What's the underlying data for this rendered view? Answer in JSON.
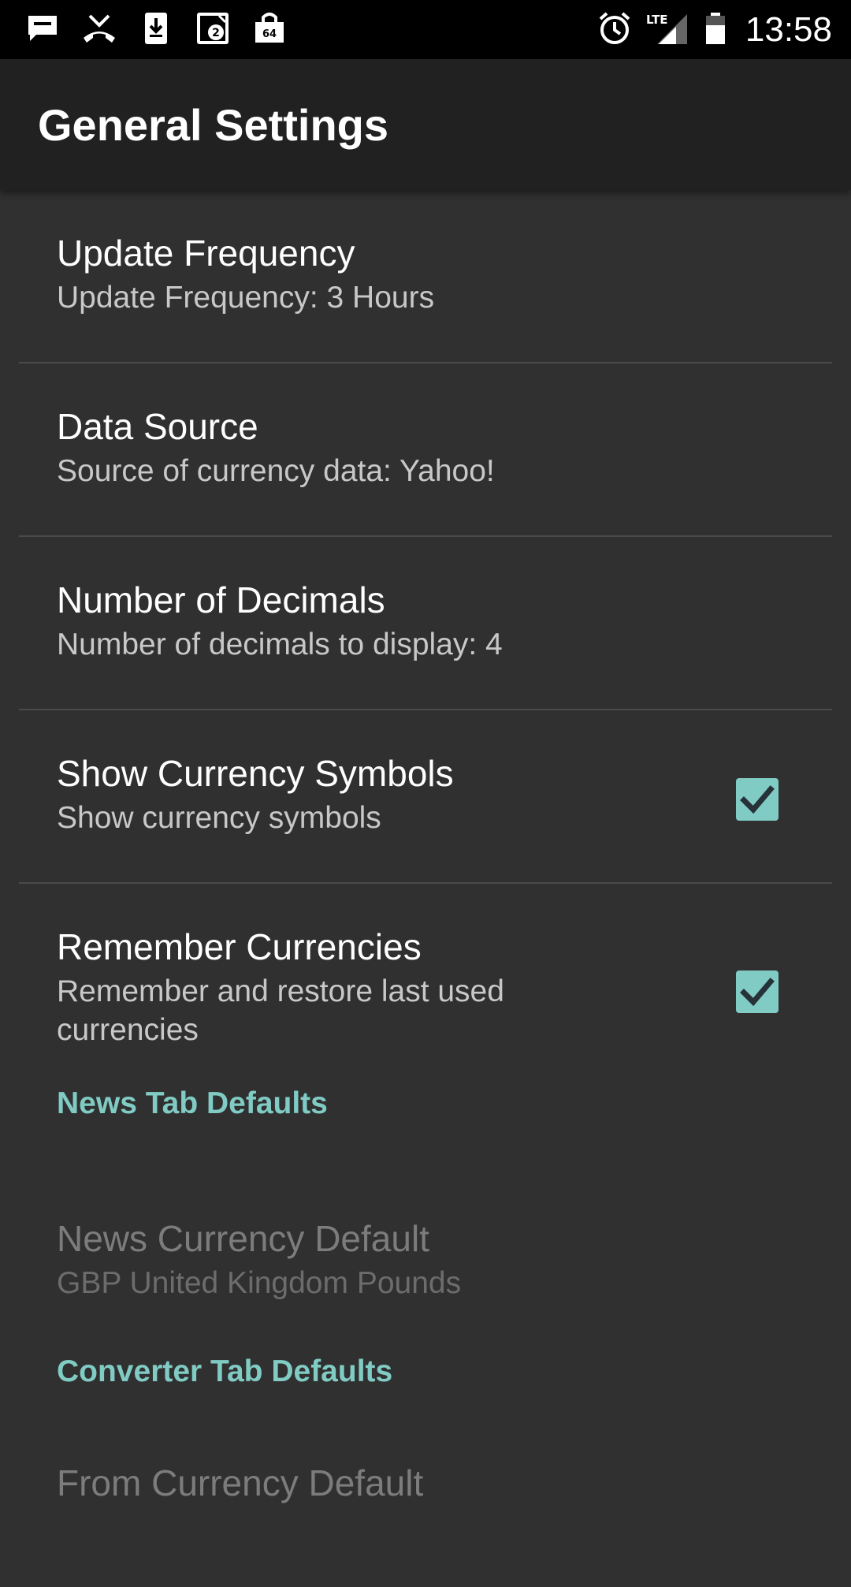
{
  "status_bar": {
    "left_icons": [
      "message-icon",
      "missed-call-icon",
      "download-icon",
      "notification-badge-icon",
      "bag-icon"
    ],
    "badge_2": "2",
    "badge_64": "64",
    "right_icons": [
      "alarm-icon",
      "lte-signal-icon",
      "battery-icon"
    ],
    "lte": "LTE",
    "time": "13:58"
  },
  "app_bar": {
    "title": "General Settings"
  },
  "preferences": [
    {
      "title": "Update Frequency",
      "summary": "Update Frequency: 3 Hours"
    },
    {
      "title": "Data Source",
      "summary": "Source of currency data: Yahoo!"
    },
    {
      "title": "Number of Decimals",
      "summary": "Number of decimals to display: 4"
    },
    {
      "title": "Show Currency Symbols",
      "summary": "Show currency symbols",
      "checked": true
    },
    {
      "title": "Remember Currencies",
      "summary": "Remember and restore last used currencies",
      "checked": true
    }
  ],
  "news_section": {
    "header": "News Tab Defaults",
    "items": [
      {
        "title": "News Currency Default",
        "summary": "GBP United Kingdom Pounds",
        "enabled": false
      }
    ]
  },
  "converter_section": {
    "header": "Converter Tab Defaults",
    "items": [
      {
        "title": "From Currency Default"
      }
    ]
  },
  "colors": {
    "accent": "#80cbc4",
    "background": "#303030",
    "app_bar": "#212121",
    "status_bar": "#000000"
  }
}
